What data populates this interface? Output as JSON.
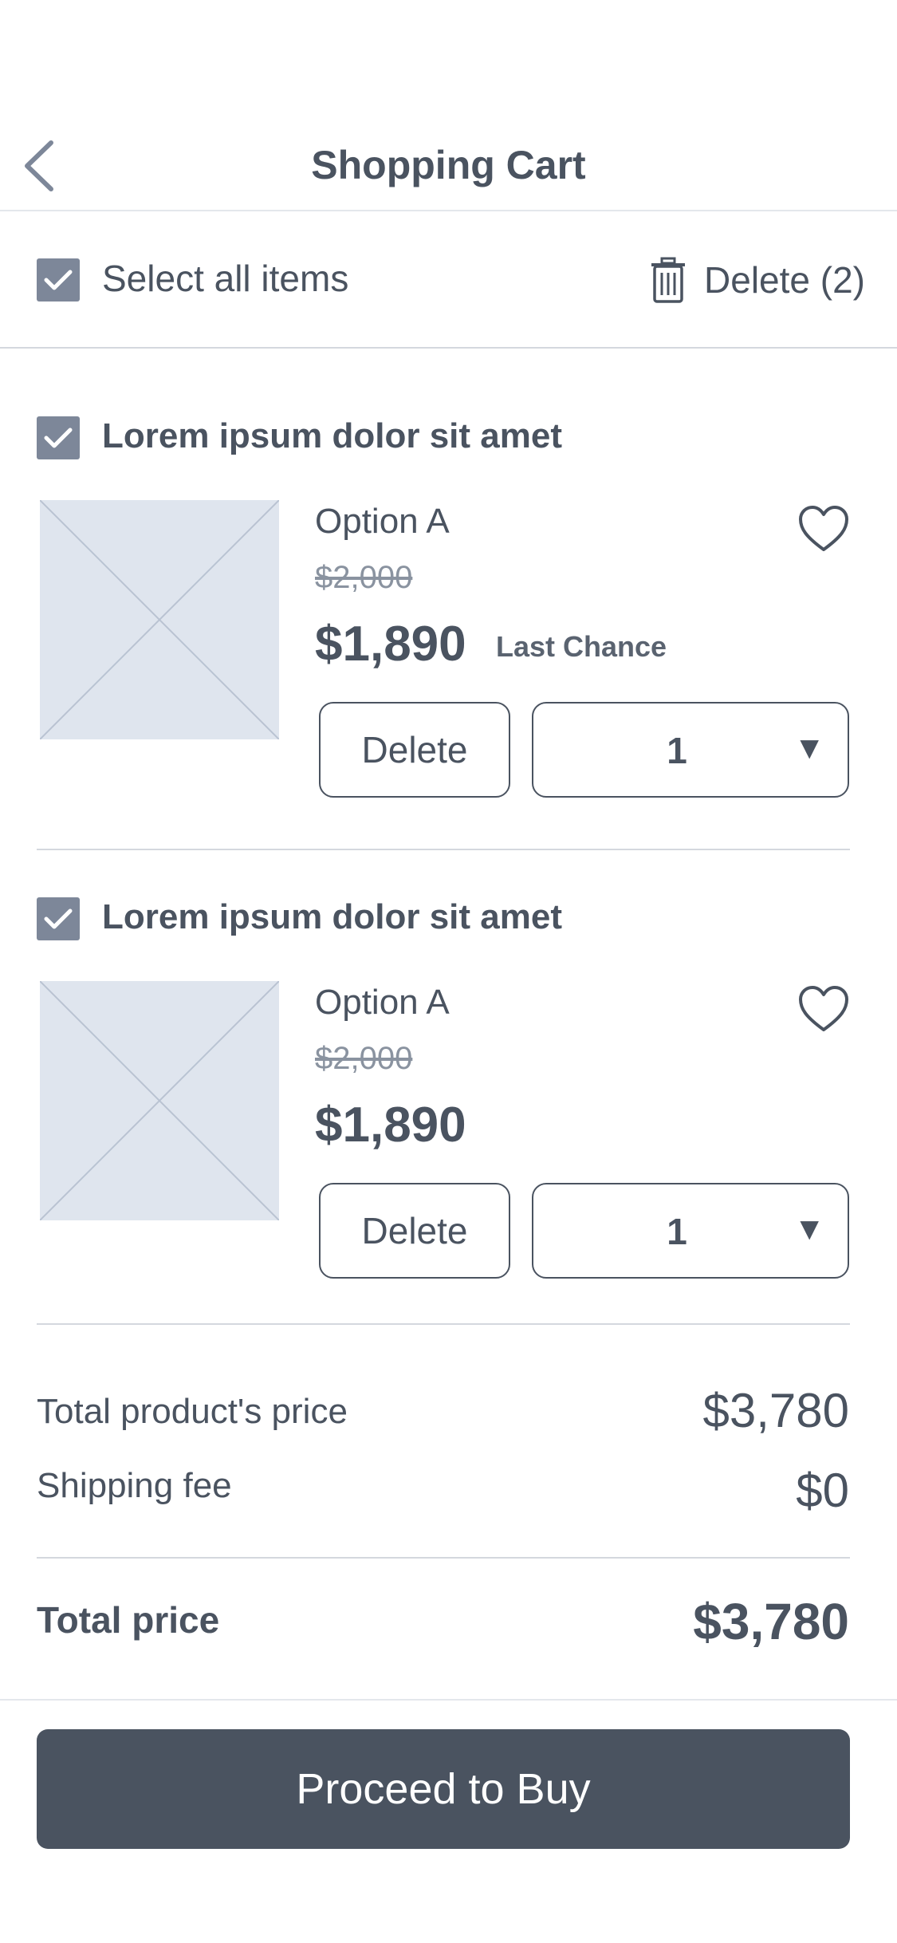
{
  "header": {
    "title": "Shopping Cart",
    "back_icon": "chevron-left-icon"
  },
  "selection": {
    "select_all_label": "Select all items",
    "select_all_checked": true,
    "delete_label": "Delete (2)",
    "delete_icon": "trash-icon"
  },
  "items": [
    {
      "title": "Lorem ipsum dolor sit amet",
      "checked": true,
      "option": "Option A",
      "original_price": "$2,000",
      "price": "$1,890",
      "badge": "Last Chance",
      "delete_label": "Delete",
      "quantity": "1",
      "dropdown_arrow": "▼"
    },
    {
      "title": "Lorem ipsum dolor sit amet",
      "checked": true,
      "option": "Option A",
      "original_price": "$2,000",
      "price": "$1,890",
      "delete_label": "Delete",
      "quantity": "1",
      "dropdown_arrow": "▼"
    }
  ],
  "summary": {
    "products_label": "Total product's price",
    "products_value": "$3,780",
    "shipping_label": "Shipping fee",
    "shipping_value": "$0",
    "total_label": "Total price",
    "total_value": "$3,780"
  },
  "checkout": {
    "button_label": "Proceed to Buy"
  },
  "colors": {
    "primary": "#4a5360",
    "checkbox": "#7d8799",
    "placeholder": "#dfe5ee",
    "divider": "#d4d8de"
  }
}
